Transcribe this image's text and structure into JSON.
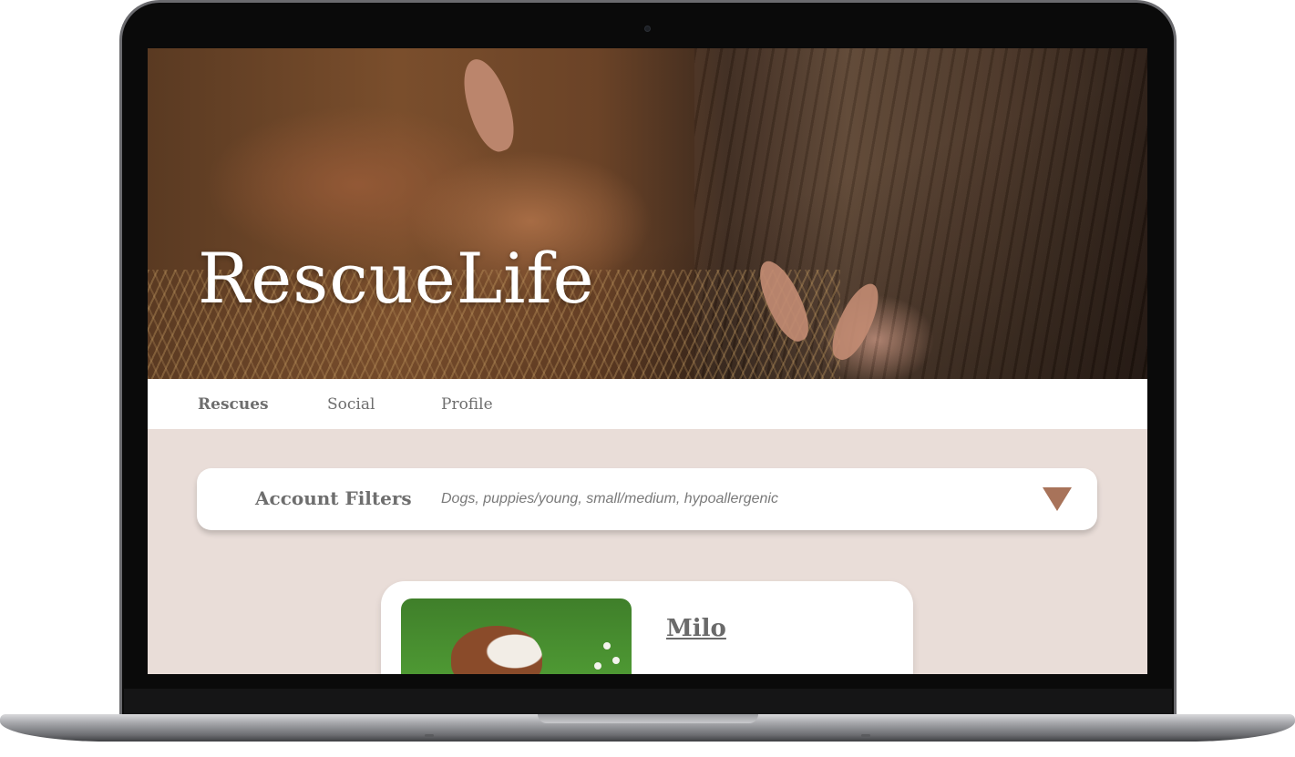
{
  "app": {
    "brand": "RescueLife"
  },
  "nav": {
    "items": [
      {
        "label": "Rescues",
        "active": true
      },
      {
        "label": "Social",
        "active": false
      },
      {
        "label": "Profile",
        "active": false
      }
    ]
  },
  "filters": {
    "label": "Account Filters",
    "value": "Dogs, puppies/young, small/medium, hypoallergenic",
    "dropdown_icon": "triangle-down-icon"
  },
  "listing": {
    "cards": [
      {
        "name": "Milo",
        "photo": "dog-photo"
      }
    ]
  },
  "colors": {
    "background": "#e9ddd8",
    "accent": "#a8735a",
    "text": "#6e6e6e"
  }
}
